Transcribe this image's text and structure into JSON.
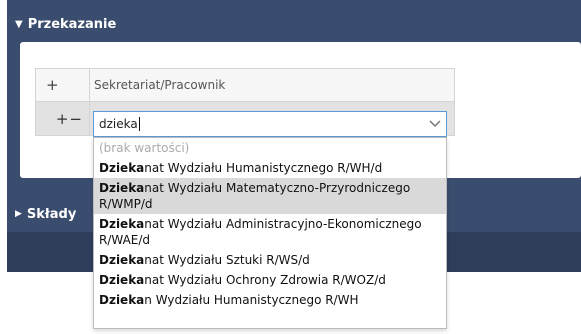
{
  "section_przekazanie": {
    "title": "Przekazanie"
  },
  "section_sklady": {
    "title": "Składy"
  },
  "table": {
    "header": {
      "add_symbol": "+",
      "column_label": "Sekretariat/Pracownik"
    },
    "edit_row": {
      "add_symbol": "+",
      "remove_symbol": "−"
    }
  },
  "combo": {
    "value": "dzieka"
  },
  "dropdown": {
    "empty_option": "(brak wartości)",
    "options": [
      {
        "match": "Dzieka",
        "rest": "nat Wydziału Humanistycznego R/WH/d"
      },
      {
        "match": "Dzieka",
        "rest": "nat Wydziału Matematyczno-Przyrodniczego R/WMP/d"
      },
      {
        "match": "Dzieka",
        "rest": "nat Wydziału Administracyjno-Ekonomicznego R/WAE/d"
      },
      {
        "match": "Dzieka",
        "rest": "nat Wydziału Sztuki R/WS/d"
      },
      {
        "match": "Dzieka",
        "rest": "nat Wydziału Ochrony Zdrowia R/WOZ/d"
      },
      {
        "match": "Dzieka",
        "rest": "n Wydziału Humanistycznego R/WH"
      }
    ]
  },
  "colors": {
    "panel": "#3b4d6e",
    "band": "#2d3d5a",
    "focus_border": "#5b9bd5",
    "highlight": "#d9d9d9"
  }
}
